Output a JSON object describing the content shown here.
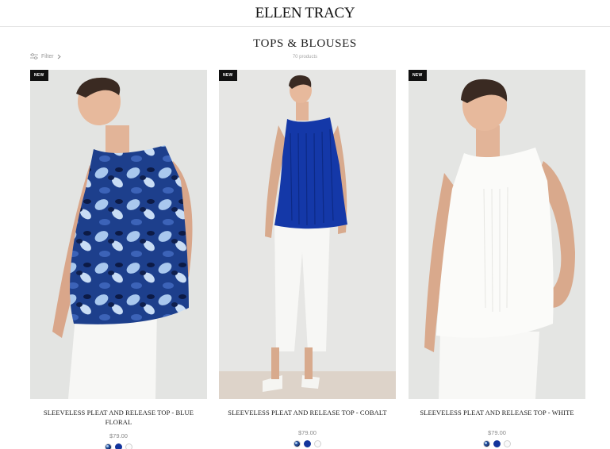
{
  "header": {
    "brand": "ELLEN TRACY"
  },
  "page": {
    "title": "TOPS & BLOUSES",
    "product_count": "70 products"
  },
  "filter": {
    "label": "Filter",
    "icon": "sliders-icon"
  },
  "products": [
    {
      "badge": "NEW",
      "name": "SLEEVELESS PLEAT AND RELEASE TOP - BLUE FLORAL",
      "price": "$79.00",
      "swatches": [
        "blue-floral",
        "cobalt",
        "white"
      ]
    },
    {
      "badge": "NEW",
      "name": "SLEEVELESS PLEAT AND RELEASE TOP - COBALT",
      "price": "$79.00",
      "swatches": [
        "blue-floral",
        "cobalt",
        "white"
      ]
    },
    {
      "badge": "NEW",
      "name": "SLEEVELESS PLEAT AND RELEASE TOP - WHITE",
      "price": "$79.00",
      "swatches": [
        "blue-floral",
        "cobalt",
        "white"
      ]
    }
  ],
  "colors": {
    "cobalt": "#13349c",
    "floral_dark": "#0f1f4d",
    "floral_light": "#9fc2ea",
    "badge_bg": "#111111"
  }
}
